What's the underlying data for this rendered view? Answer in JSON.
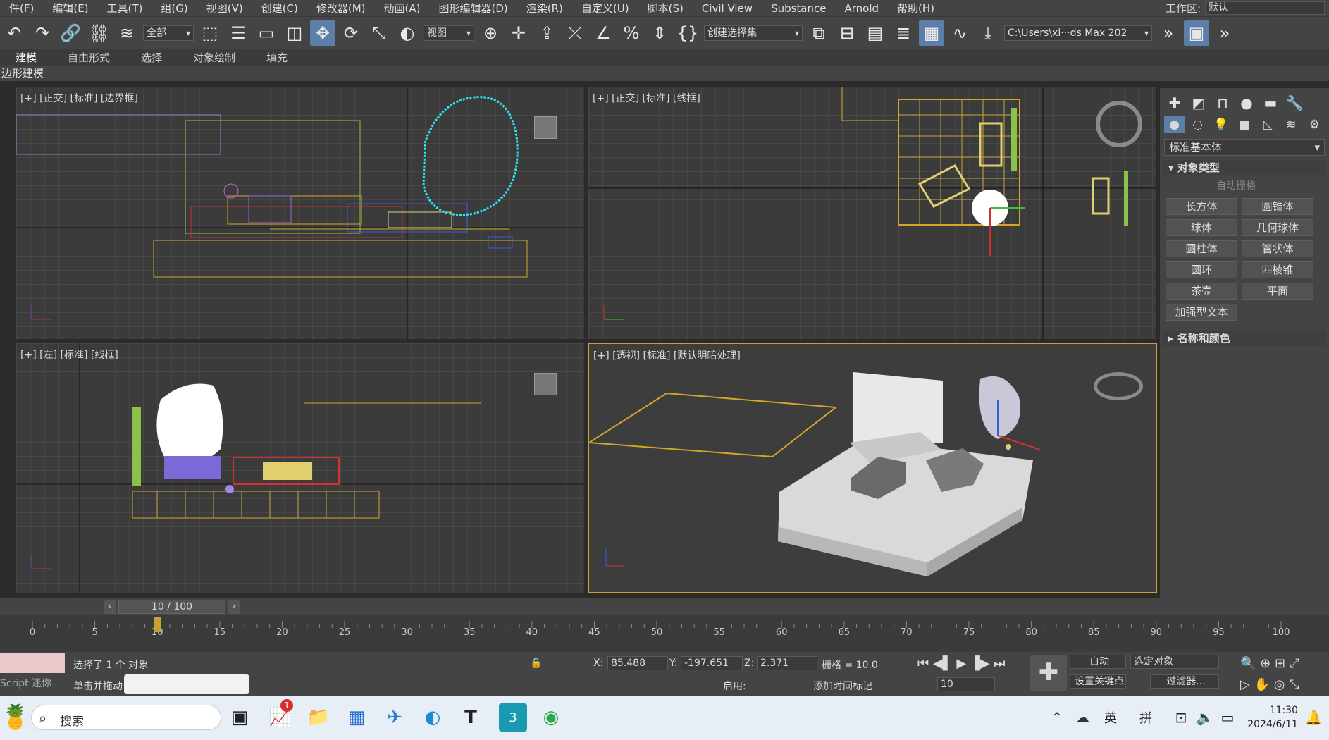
{
  "menu": [
    "件(F)",
    "编辑(E)",
    "工具(T)",
    "组(G)",
    "视图(V)",
    "创建(C)",
    "修改器(M)",
    "动画(A)",
    "图形编辑器(D)",
    "渲染(R)",
    "自定义(U)",
    "脚本(S)",
    "Civil View",
    "Substance",
    "Arnold",
    "帮助(H)"
  ],
  "workspace": {
    "label": "工作区:",
    "value": "默认"
  },
  "toolbar": {
    "filter": "全部",
    "refcoord": "视图",
    "selset": "创建选择集",
    "path": "C:\\Users\\xi···ds Max 202"
  },
  "ribbon": {
    "tabs": [
      "建模",
      "自由形式",
      "选择",
      "对象绘制",
      "填充"
    ],
    "sub": "边形建模"
  },
  "viewports": {
    "front": "[+] [正交] [标准] [边界框]",
    "top": "[+] [正交] [标准] [线框]",
    "left": "[+] [左] [标准] [线框]",
    "persp": "[+] [透视] [标准] [默认明暗处理]"
  },
  "panel": {
    "combo": "标准基本体",
    "rollout_type": "对象类型",
    "autogrid": "自动栅格",
    "buttons": [
      "长方体",
      "圆锥体",
      "球体",
      "几何球体",
      "圆柱体",
      "管状体",
      "圆环",
      "四棱锥",
      "茶壶",
      "平面",
      "加强型文本"
    ],
    "rollout_name": "名称和颜色"
  },
  "timeline": {
    "frame": "10 / 100",
    "ticks": [
      "0",
      "5",
      "10",
      "15",
      "20",
      "25",
      "30",
      "35",
      "40",
      "45",
      "50",
      "55",
      "60",
      "65",
      "70",
      "75",
      "80",
      "85",
      "90",
      "95",
      "100"
    ]
  },
  "status": {
    "script": "Script 迷你",
    "selected": "选择了 1 个 对象",
    "hint": "单击并拖动",
    "x_label": "X:",
    "x": "85.488",
    "y_label": "Y:",
    "y": "-197.651",
    "z_label": "Z:",
    "z": "2.371",
    "grid": "栅格 = 10.0",
    "auto": "自动",
    "selobj": "选定对象",
    "setkey": "设置关键点",
    "filters": "过滤器...",
    "enable": "启用:",
    "addtag": "添加时间标记",
    "frame_field": "10"
  },
  "taskbar": {
    "search": "搜索",
    "ime1": "英",
    "ime2": "拼",
    "time": "11:30",
    "date": "2024/6/11",
    "badge": "1"
  }
}
